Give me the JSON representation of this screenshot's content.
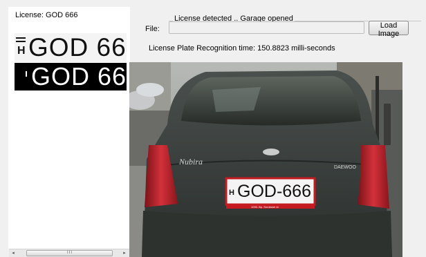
{
  "result": {
    "license_caption": "License: GOD 666",
    "plate_text": "GOD 66",
    "plate_country": "H"
  },
  "status": {
    "title": "License detected .. Garage opened"
  },
  "file": {
    "label": "File:",
    "value": "",
    "load_button_label": "Load Image"
  },
  "timing": {
    "text": "License Plate Recognition time: 150.8823 milli-seconds"
  },
  "photo": {
    "car_badge": "Nubira",
    "car_brand": "DAEWOO",
    "plate_country": "H",
    "plate_text": "GOD-666",
    "dealer_text": "1093. Bp. Soroksári út"
  },
  "scrollbar": {
    "left_arrow": "◂",
    "right_arrow": "▸",
    "grip": "III"
  },
  "colors": {
    "window_bg": "#f0f0f0",
    "panel_bg": "#ffffff",
    "car_body": "#3a3f3c",
    "taillight": "#b8202a",
    "plate_border": "#c41a22"
  }
}
